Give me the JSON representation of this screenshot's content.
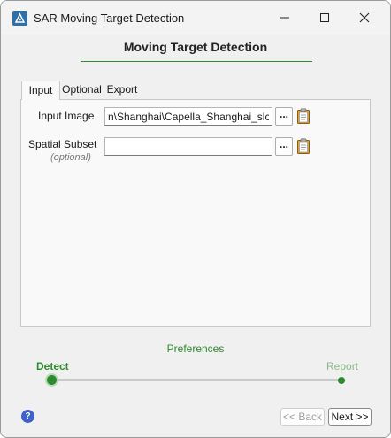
{
  "window": {
    "title": "SAR Moving Target Detection",
    "icon": "sar-app-icon",
    "controls": {
      "minimize": "minimize-icon",
      "maximize": "maximize-icon",
      "close": "close-icon"
    }
  },
  "header": {
    "title": "Moving Target Detection",
    "accent_color": "#2e8b2e"
  },
  "tabs": [
    {
      "label": "Input",
      "active": true
    },
    {
      "label": "Optional",
      "active": false
    },
    {
      "label": "Export",
      "active": false
    }
  ],
  "input_tab": {
    "input_image": {
      "label": "Input Image",
      "value": "n\\Shanghai\\Capella_Shanghai_slc.sml",
      "browse_label": "..."
    },
    "spatial_subset": {
      "label": "Spatial Subset",
      "hint": "(optional)",
      "value": "",
      "browse_label": "..."
    }
  },
  "wizard": {
    "preferences_label": "Preferences",
    "steps": [
      {
        "label": "Detect",
        "active": true
      },
      {
        "label": "Report",
        "active": false
      }
    ],
    "help_label": "?",
    "back_label": "<< Back",
    "next_label": "Next >>"
  }
}
